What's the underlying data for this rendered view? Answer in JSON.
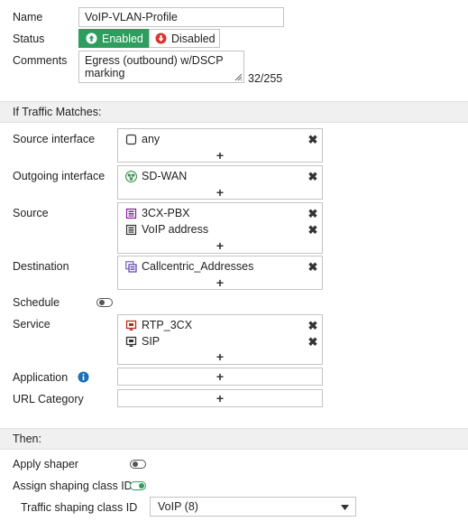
{
  "name": {
    "label": "Name",
    "value": "VoIP-VLAN-Profile"
  },
  "status": {
    "label": "Status",
    "enabled": "Enabled",
    "disabled": "Disabled",
    "active_color": "#2e9e5e"
  },
  "comments": {
    "label": "Comments",
    "value": "Egress (outbound) w/DSCP marking",
    "counter": "32/255"
  },
  "if_traffic": {
    "header": "If Traffic Matches:"
  },
  "source_interface": {
    "label": "Source interface",
    "items": [
      {
        "text": "any",
        "icon": "interface-icon"
      }
    ]
  },
  "outgoing_interface": {
    "label": "Outgoing interface",
    "items": [
      {
        "text": "SD-WAN",
        "icon": "sdwan-icon"
      }
    ]
  },
  "source": {
    "label": "Source",
    "items": [
      {
        "text": "3CX-PBX",
        "icon": "address-icon"
      },
      {
        "text": "VoIP address",
        "icon": "address-icon"
      }
    ]
  },
  "destination": {
    "label": "Destination",
    "items": [
      {
        "text": "Callcentric_Addresses",
        "icon": "address-group-icon"
      }
    ]
  },
  "schedule": {
    "label": "Schedule",
    "enabled": false
  },
  "service": {
    "label": "Service",
    "items": [
      {
        "text": "RTP_3CX",
        "icon": "service-icon"
      },
      {
        "text": "SIP",
        "icon": "service-icon"
      }
    ]
  },
  "application": {
    "label": "Application"
  },
  "url_category": {
    "label": "URL Category"
  },
  "then": {
    "header": "Then:"
  },
  "apply_shaper": {
    "label": "Apply shaper",
    "enabled": false
  },
  "assign_class": {
    "label": "Assign shaping class ID",
    "enabled": true
  },
  "traffic_class": {
    "label": "Traffic shaping class ID",
    "value": "VoIP (8)"
  },
  "symbols": {
    "plus": "+",
    "remove": "✖"
  }
}
